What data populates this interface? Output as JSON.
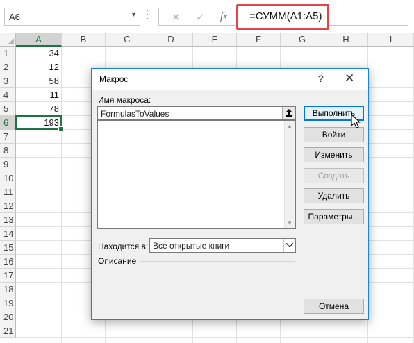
{
  "name_box": {
    "value": "A6",
    "dropdown_glyph": "▾"
  },
  "formula_bar": {
    "cancel_glyph": "✕",
    "enter_glyph": "✓",
    "fx_label": "fx",
    "formula": "=СУММ(A1:A5)"
  },
  "columns": [
    "A",
    "B",
    "C",
    "D",
    "E",
    "F",
    "G",
    "H",
    "I"
  ],
  "rows": [
    "1",
    "2",
    "3",
    "4",
    "5",
    "6",
    "7",
    "8",
    "9",
    "10",
    "11",
    "12",
    "13",
    "14",
    "15",
    "16",
    "17",
    "18",
    "19",
    "20",
    "21"
  ],
  "cells": {
    "a1": "34",
    "a2": "12",
    "a3": "58",
    "a4": "11",
    "a5": "78",
    "a6": "193"
  },
  "selected_cell": "A6",
  "dialog": {
    "title": "Макрос",
    "help_glyph": "?",
    "close_glyph": "✕",
    "macro_name_label": "Имя макроса:",
    "macro_name_value": "FormulasToValues",
    "macro_list_items": [],
    "buttons": {
      "run": "Выполнить",
      "step_into": "Войти",
      "edit": "Изменить",
      "create": "Создать",
      "delete": "Удалить",
      "options": "Параметры...",
      "cancel": "Отмена"
    },
    "location_label": "Находится в:",
    "location_value": "Все открытые книги",
    "description_label": "Описание"
  },
  "colors": {
    "excel_green": "#217346",
    "highlight_red": "#e5434a",
    "dialog_border": "#1883d7",
    "primary_button_border": "#0078d7"
  }
}
